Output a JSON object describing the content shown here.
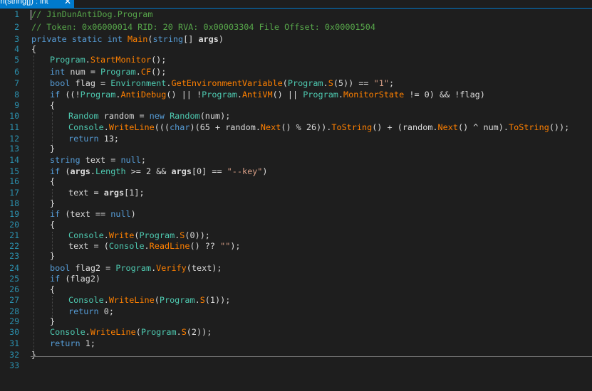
{
  "tab": {
    "title": "in(string[]) : int",
    "close": "✕"
  },
  "line_numbers": [
    "1",
    "2",
    "3",
    "4",
    "5",
    "6",
    "7",
    "8",
    "9",
    "10",
    "11",
    "12",
    "13",
    "14",
    "15",
    "16",
    "17",
    "18",
    "19",
    "20",
    "21",
    "22",
    "23",
    "24",
    "25",
    "26",
    "27",
    "28",
    "29",
    "30",
    "31",
    "32",
    "33"
  ],
  "code": {
    "l1": "// JinDunAntiDog.Program",
    "l2": "// Token: 0x06000014 RID: 20 RVA: 0x00003304 File Offset: 0x00001504",
    "l3_kw1": "private",
    "l3_kw2": "static",
    "l3_kw3": "int",
    "l3_name": "Main",
    "l3_p1": "(",
    "l3_kw4": "string",
    "l3_p2": "[] ",
    "l3_arg": "args",
    "l3_p3": ")",
    "l4": "{",
    "l5_a": "Program",
    "l5_b": ".",
    "l5_c": "StartMonitor",
    "l5_d": "();",
    "l6_a": "int",
    "l6_b": " num = ",
    "l6_c": "Program",
    "l6_d": ".",
    "l6_e": "CF",
    "l6_f": "();",
    "l7_a": "bool",
    "l7_b": " flag = ",
    "l7_c": "Environment",
    "l7_d": ".",
    "l7_e": "GetEnvironmentVariable",
    "l7_f": "(",
    "l7_g": "Program",
    "l7_h": ".",
    "l7_i": "S",
    "l7_j": "(5)) == ",
    "l7_k": "\"1\"",
    "l7_l": ";",
    "l8_a": "if",
    "l8_b": " ((!",
    "l8_c": "Program",
    "l8_d": ".",
    "l8_e": "AntiDebug",
    "l8_f": "() || !",
    "l8_g": "Program",
    "l8_h": ".",
    "l8_i": "AntiVM",
    "l8_j": "() || ",
    "l8_k": "Program",
    "l8_l": ".",
    "l8_m": "MonitorState",
    "l8_n": " != 0) && !flag)",
    "l9": "{",
    "l10_a": "Random",
    "l10_b": " random = ",
    "l10_c": "new",
    "l10_d": " ",
    "l10_e": "Random",
    "l10_f": "(num);",
    "l11_a": "Console",
    "l11_b": ".",
    "l11_c": "WriteLine",
    "l11_d": "(((",
    "l11_e": "char",
    "l11_f": ")(65 + random.",
    "l11_g": "Next",
    "l11_h": "() % 26)).",
    "l11_i": "ToString",
    "l11_j": "() + (random.",
    "l11_k": "Next",
    "l11_l": "() ^ num).",
    "l11_m": "ToString",
    "l11_n": "());",
    "l12_a": "return",
    "l12_b": " 13;",
    "l13": "}",
    "l14_a": "string",
    "l14_b": " text = ",
    "l14_c": "null",
    "l14_d": ";",
    "l15_a": "if",
    "l15_b": " (",
    "l15_c": "args",
    "l15_d": ".",
    "l15_e": "Length",
    "l15_f": " >= 2 && ",
    "l15_g": "args",
    "l15_h": "[0] == ",
    "l15_i": "\"--key\"",
    "l15_j": ")",
    "l16": "{",
    "l17_a": "text = ",
    "l17_b": "args",
    "l17_c": "[1];",
    "l18": "}",
    "l19_a": "if",
    "l19_b": " (text == ",
    "l19_c": "null",
    "l19_d": ")",
    "l20": "{",
    "l21_a": "Console",
    "l21_b": ".",
    "l21_c": "Write",
    "l21_d": "(",
    "l21_e": "Program",
    "l21_f": ".",
    "l21_g": "S",
    "l21_h": "(0));",
    "l22_a": "text = (",
    "l22_b": "Console",
    "l22_c": ".",
    "l22_d": "ReadLine",
    "l22_e": "() ?? ",
    "l22_f": "\"\"",
    "l22_g": ");",
    "l23": "}",
    "l24_a": "bool",
    "l24_b": " flag2 = ",
    "l24_c": "Program",
    "l24_d": ".",
    "l24_e": "Verify",
    "l24_f": "(text);",
    "l25_a": "if",
    "l25_b": " (flag2)",
    "l26": "{",
    "l27_a": "Console",
    "l27_b": ".",
    "l27_c": "WriteLine",
    "l27_d": "(",
    "l27_e": "Program",
    "l27_f": ".",
    "l27_g": "S",
    "l27_h": "(1));",
    "l28_a": "return",
    "l28_b": " 0;",
    "l29": "}",
    "l30_a": "Console",
    "l30_b": ".",
    "l30_c": "WriteLine",
    "l30_d": "(",
    "l30_e": "Program",
    "l30_f": ".",
    "l30_g": "S",
    "l30_h": "(2));",
    "l31_a": "return",
    "l31_b": " 1;",
    "l32": "}"
  }
}
